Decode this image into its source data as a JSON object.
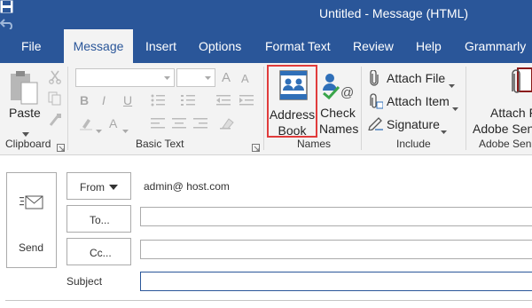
{
  "title": "Untitled  -  Message (HTML)",
  "quick_access": [
    "save-icon",
    "undo-icon",
    "redo-icon",
    "up-arrow-icon",
    "down-arrow-icon",
    "touch-mode-icon",
    "customize-qat-icon"
  ],
  "tabs": [
    {
      "label": "File",
      "active": false
    },
    {
      "label": "Message",
      "active": true
    },
    {
      "label": "Insert",
      "active": false
    },
    {
      "label": "Options",
      "active": false
    },
    {
      "label": "Format Text",
      "active": false
    },
    {
      "label": "Review",
      "active": false
    },
    {
      "label": "Help",
      "active": false
    },
    {
      "label": "Grammarly",
      "active": false
    }
  ],
  "ribbon": {
    "clipboard": {
      "paste_label": "Paste",
      "group_label": "Clipboard"
    },
    "basic_text": {
      "group_label": "Basic Text",
      "bold": "B",
      "italic": "I",
      "underline": "U",
      "grow": "A",
      "shrink": "A"
    },
    "names": {
      "address_book_line1": "Address",
      "address_book_line2": "Book",
      "check_names_line1": "Check",
      "check_names_line2": "Names",
      "group_label": "Names"
    },
    "include": {
      "attach_file": "Attach File",
      "attach_item": "Attach Item",
      "signature": "Signature",
      "group_label": "Include"
    },
    "adobe": {
      "line1": "Attach F",
      "line2": "Adobe Sen",
      "group_label": "Adobe Sen"
    }
  },
  "compose": {
    "send_label": "Send",
    "from_label": "From",
    "from_value": "admin@ host.com",
    "to_label": "To...",
    "cc_label": "Cc...",
    "subject_label": "Subject",
    "to_value": "",
    "cc_value": "",
    "subject_value": ""
  },
  "colors": {
    "accent": "#2a5699",
    "highlight": "#e03c3c",
    "ribbon_bg": "#f3f3f3"
  }
}
